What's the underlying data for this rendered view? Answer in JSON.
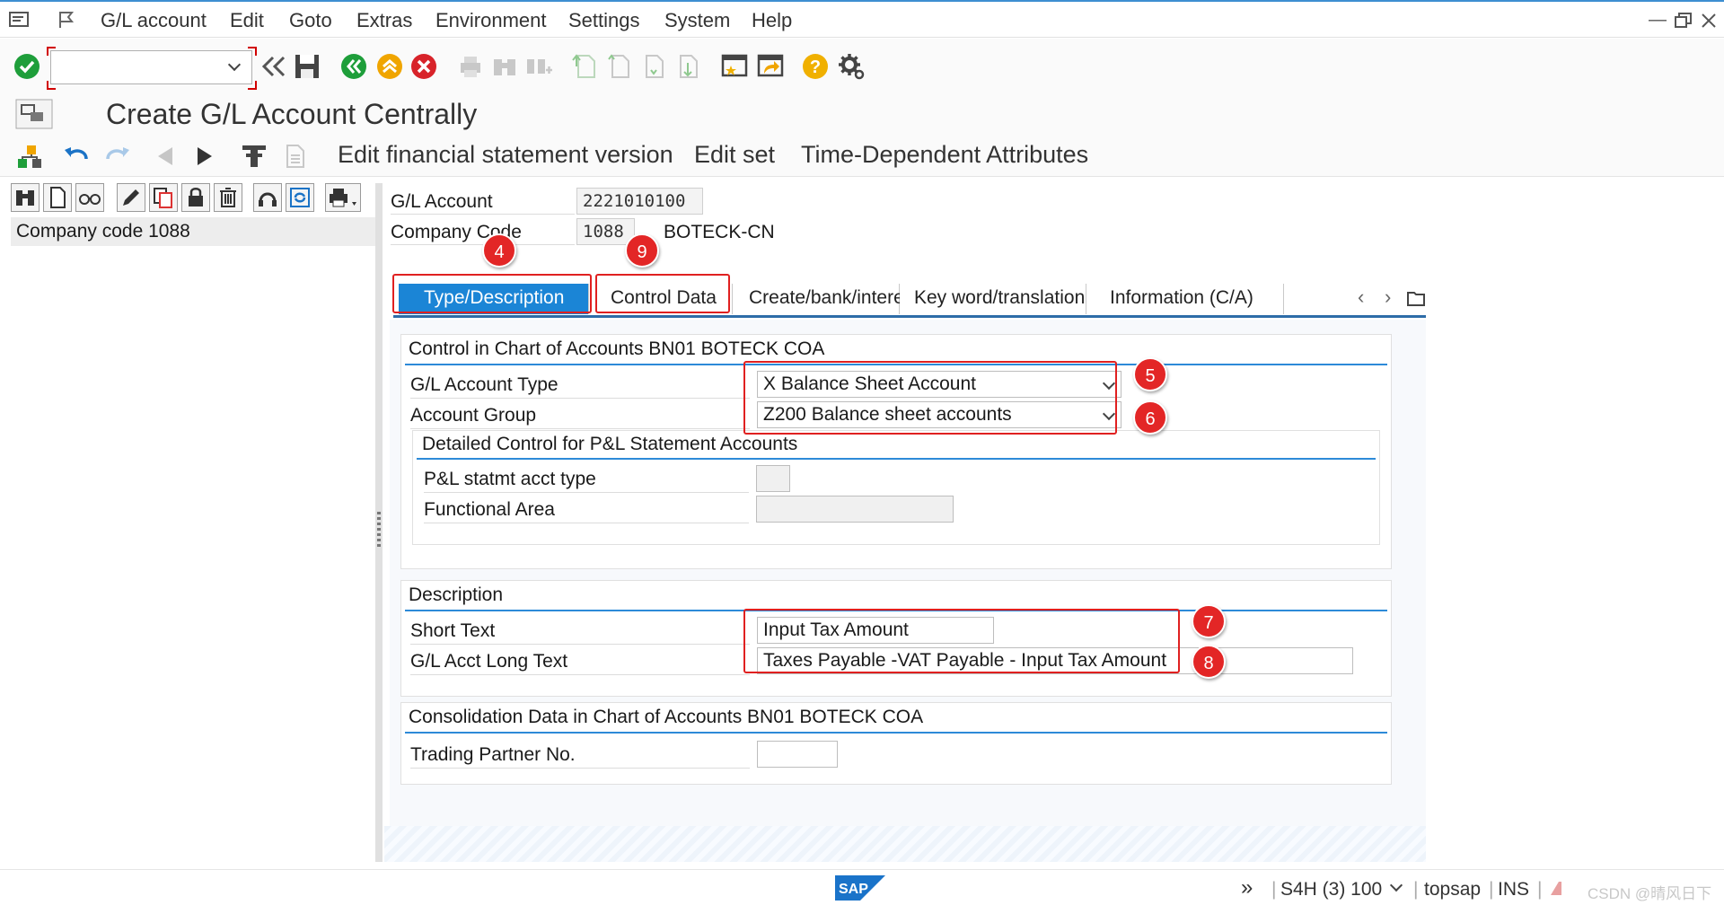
{
  "menubar": {
    "items": [
      "G/L account",
      "Edit",
      "Goto",
      "Extras",
      "Environment",
      "Settings",
      "System",
      "Help"
    ]
  },
  "toolbar": {
    "command_field_value": "",
    "icons": [
      "enter-icon",
      "back-double-icon",
      "save-icon",
      "back-icon",
      "exit-icon",
      "cancel-icon",
      "print-icon",
      "find-icon",
      "find-next-icon",
      "first-page-icon",
      "previous-page-icon",
      "next-page-icon",
      "last-page-icon",
      "create-session-icon",
      "shortcut-icon",
      "help-icon",
      "settings-icon"
    ]
  },
  "title": "Create G/L Account Centrally",
  "app_toolbar": {
    "buttons": [
      "Edit financial statement version",
      "Edit set",
      "Time-Dependent Attributes"
    ]
  },
  "left_pane": {
    "item": "Company code 1088"
  },
  "header": {
    "gl_account_label": "G/L Account",
    "gl_account_value": "2221010100",
    "company_code_label": "Company Code",
    "company_code_value": "1088",
    "company_name": "BOTECK-CN"
  },
  "tabs": [
    {
      "label": "Type/Description",
      "active": true
    },
    {
      "label": "Control Data",
      "active": false
    },
    {
      "label": "Create/bank/interest",
      "active": false
    },
    {
      "label": "Key word/translation",
      "active": false
    },
    {
      "label": "Information (C/A)",
      "active": false
    }
  ],
  "group_control": {
    "title": "Control in Chart of Accounts BN01 BOTECK COA",
    "account_type_label": "G/L Account Type",
    "account_type_value": "X Balance Sheet Account",
    "account_group_label": "Account Group",
    "account_group_value": "Z200 Balance sheet accounts",
    "pl_group_title": "Detailed Control for P&L Statement Accounts",
    "pl_type_label": "P&L statmt acct type",
    "pl_type_value": "",
    "functional_area_label": "Functional Area",
    "functional_area_value": ""
  },
  "group_description": {
    "title": "Description",
    "short_text_label": "Short Text",
    "short_text_value": "Input Tax Amount",
    "long_text_label": "G/L Acct Long Text",
    "long_text_value": "Taxes Payable -VAT Payable - Input Tax Amount"
  },
  "group_consolidation": {
    "title": "Consolidation Data in Chart of Accounts BN01 BOTECK COA",
    "trading_partner_label": "Trading Partner No.",
    "trading_partner_value": ""
  },
  "annotations": [
    "4",
    "9",
    "5",
    "6",
    "7",
    "8"
  ],
  "statusbar": {
    "logo": "SAP",
    "system": "S4H (3) 100",
    "server": "topsap",
    "mode": "INS",
    "watermark": "CSDN @晴风日下"
  },
  "colors": {
    "active_tab": "#1b85d6",
    "annotation_red": "#e32626",
    "group_rule": "#2d8ad8"
  }
}
